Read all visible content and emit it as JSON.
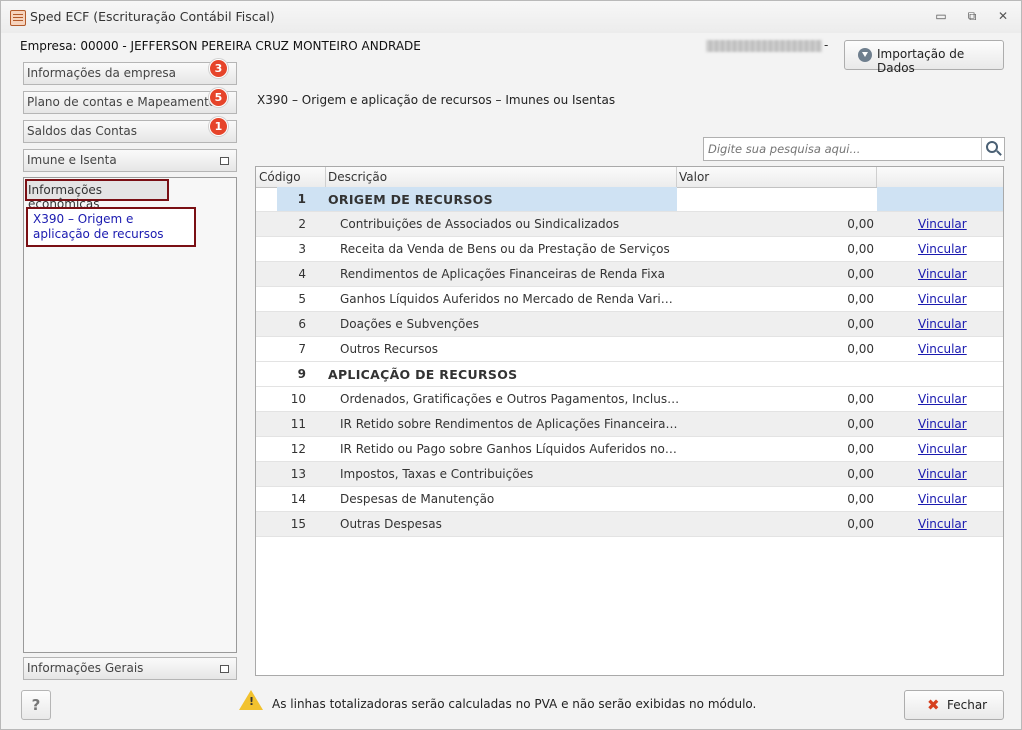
{
  "window": {
    "title": "Sped ECF (Escrituração Contábil Fiscal)",
    "controls": {
      "minimize": "▭",
      "restore": "⧉",
      "close": "✕"
    }
  },
  "header": {
    "empresa": "Empresa: 00000 - JEFFERSON PEREIRA CRUZ MONTEIRO ANDRADE",
    "masked_suffix": "-",
    "import_button": "Importação de Dados"
  },
  "sidebar": {
    "items": [
      {
        "label": "Informações da empresa",
        "badge": "3"
      },
      {
        "label": "Plano de contas e Mapeamento",
        "badge": "5"
      },
      {
        "label": "Saldos das Contas",
        "badge": "1"
      },
      {
        "label": "Imune e Isenta",
        "badge": ""
      }
    ],
    "active_section": "Informações econômicas",
    "active_link": "X390 – Origem e aplicação de recursos",
    "bottom_item": "Informações Gerais"
  },
  "main": {
    "title": "X390 – Origem e aplicação de recursos – Imunes ou Isentas",
    "search_placeholder": "Digite sua pesquisa aqui...",
    "columns": [
      "Código",
      "Descrição",
      "Valor",
      ""
    ],
    "rows": [
      {
        "code": "1",
        "desc": "ORIGEM DE RECURSOS",
        "value": "",
        "action": "",
        "header": true
      },
      {
        "code": "2",
        "desc": "Contribuições de Associados ou Sindicalizados",
        "value": "0,00",
        "action": "Vincular"
      },
      {
        "code": "3",
        "desc": "Receita da Venda de Bens ou da Prestação de Serviços",
        "value": "0,00",
        "action": "Vincular"
      },
      {
        "code": "4",
        "desc": "Rendimentos de Aplicações Financeiras de Renda Fixa",
        "value": "0,00",
        "action": "Vincular"
      },
      {
        "code": "5",
        "desc": "Ganhos Líquidos Auferidos no Mercado de Renda Variável",
        "value": "0,00",
        "action": "Vincular"
      },
      {
        "code": "6",
        "desc": "Doações e Subvenções",
        "value": "0,00",
        "action": "Vincular"
      },
      {
        "code": "7",
        "desc": "Outros Recursos",
        "value": "0,00",
        "action": "Vincular"
      },
      {
        "code": "9",
        "desc": "APLICAÇÃO DE RECURSOS",
        "value": "",
        "action": "",
        "header": true
      },
      {
        "code": "10",
        "desc": "Ordenados, Gratificações e Outros Pagamentos, Inclusive Enc...",
        "value": "0,00",
        "action": "Vincular"
      },
      {
        "code": "11",
        "desc": "IR Retido sobre Rendimentos de Aplicações Financeiras de Re...",
        "value": "0,00",
        "action": "Vincular"
      },
      {
        "code": "12",
        "desc": "IR Retido ou Pago sobre Ganhos Líquidos Auferidos no Merca...",
        "value": "0,00",
        "action": "Vincular"
      },
      {
        "code": "13",
        "desc": "Impostos, Taxas e Contribuições",
        "value": "0,00",
        "action": "Vincular"
      },
      {
        "code": "14",
        "desc": "Despesas de Manutenção",
        "value": "0,00",
        "action": "Vincular"
      },
      {
        "code": "15",
        "desc": "Outras Despesas",
        "value": "0,00",
        "action": "Vincular"
      }
    ]
  },
  "footer": {
    "help": "?",
    "warning_mark": "!",
    "warning": "As linhas totalizadoras serão calculadas no PVA e não serão exibidas no módulo.",
    "close_button": "Fechar",
    "close_icon": "✖"
  }
}
